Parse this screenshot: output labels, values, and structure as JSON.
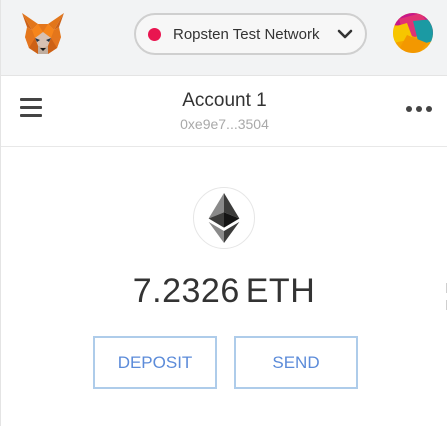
{
  "header": {
    "logo_icon": "metamask-fox-icon",
    "network": {
      "label": "Ropsten Test Network",
      "dot_color": "#e91550",
      "chevron_icon": "chevron-down-icon"
    },
    "account_avatar_icon": "identicon-avatar"
  },
  "account": {
    "menu_icon": "hamburger-menu-icon",
    "name": "Account 1",
    "address": "0xe9e7...3504",
    "more_icon": "more-options-icon"
  },
  "wallet": {
    "token_icon": "ethereum-icon",
    "balance_amount": "7.2326",
    "balance_unit": "ETH",
    "deposit_label": "DEPOSIT",
    "send_label": "SEND"
  },
  "colors": {
    "accent_text": "#5b8bd9",
    "button_border": "#aeccea",
    "network_dot": "#e91550"
  }
}
